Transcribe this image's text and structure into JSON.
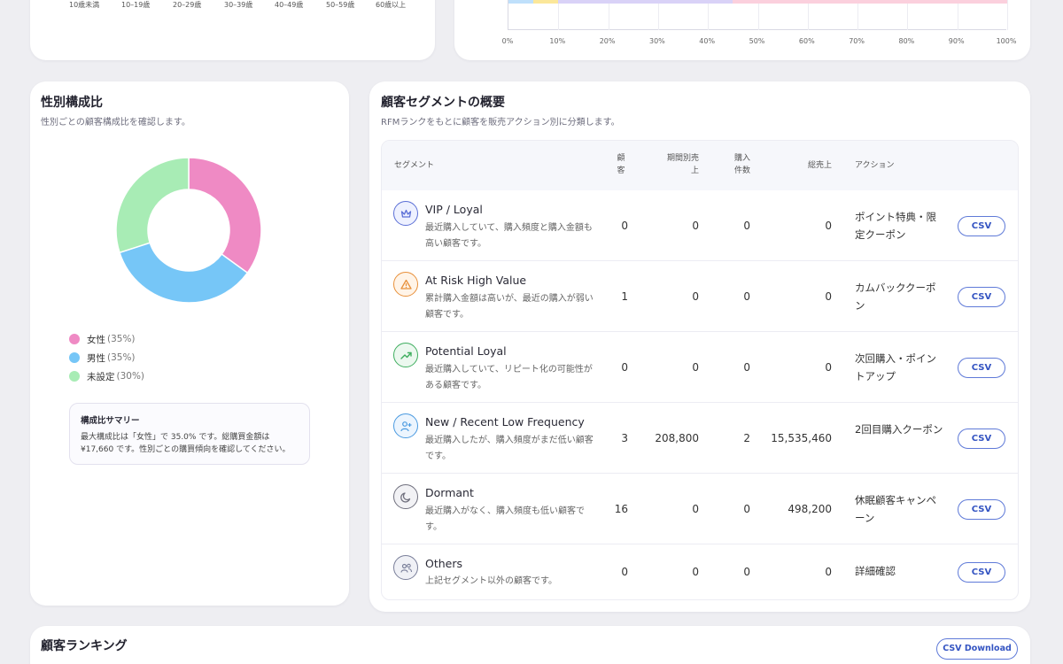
{
  "age_chart": {
    "tick_labels": [
      "10歳未満",
      "10–19歳",
      "20–29歳",
      "30–39歳",
      "40–49歳",
      "50–59歳",
      "60歳以上"
    ]
  },
  "stacked_bar": {
    "x_ticks": [
      "0%",
      "10%",
      "20%",
      "30%",
      "40%",
      "50%",
      "60%",
      "70%",
      "80%",
      "90%",
      "100%"
    ],
    "segment_colors": [
      "#bfe0fb",
      "#fbe79a",
      "#d9d2f7",
      "#fbd0dd"
    ],
    "segment_shares": [
      5,
      5,
      35,
      55
    ]
  },
  "gender": {
    "title": "性別構成比",
    "subtitle": "性別ごとの顧客構成比を確認します。",
    "legend": [
      {
        "label": "女性",
        "pct": "(35%)",
        "color": "#ef8ac4",
        "value": 35
      },
      {
        "label": "男性",
        "pct": "(35%)",
        "color": "#76c6f7",
        "value": 35
      },
      {
        "label": "未設定",
        "pct": "(30%)",
        "color": "#a8ecb5",
        "value": 30
      }
    ],
    "summary": {
      "title": "構成比サマリー",
      "text": "最大構成比は「女性」で 35.0% です。総購買金額は ¥17,660 です。性別ごとの購買傾向を確認してください。"
    }
  },
  "segments": {
    "title": "顧客セグメントの概要",
    "subtitle": "RFMランクをもとに顧客を販売アクション別に分類します。",
    "headers": {
      "segment": "セグメント",
      "customers": "顧\n客",
      "period_sales": "期間別売\n上",
      "purchase_count": "購入\n件数",
      "total_sales": "総売上",
      "action": "アクション"
    },
    "rows": [
      {
        "name": "VIP / Loyal",
        "desc": "最近購入していて、購入頻度と購入金額も高い顧客です。",
        "customers": "0",
        "period_sales": "0",
        "purchase_count": "0",
        "total_sales": "0",
        "action": "ポイント特典・限定クーポン",
        "csv": "CSV",
        "icon": "crown-icon",
        "icon_color": "#5b6fd6",
        "icon_bg": "#eef1ff"
      },
      {
        "name": "At Risk High Value",
        "desc": "累計購入金額は高いが、最近の購入が弱い顧客です。",
        "customers": "1",
        "period_sales": "0",
        "purchase_count": "0",
        "total_sales": "0",
        "action": "カムバッククーポン",
        "csv": "CSV",
        "icon": "warning-icon",
        "icon_color": "#e8903a",
        "icon_bg": "#fff4e8"
      },
      {
        "name": "Potential Loyal",
        "desc": "最近購入していて、リピート化の可能性がある顧客です。",
        "customers": "0",
        "period_sales": "0",
        "purchase_count": "0",
        "total_sales": "0",
        "action": "次回購入・ポイントアップ",
        "csv": "CSV",
        "icon": "trend-up-icon",
        "icon_color": "#3fae5f",
        "icon_bg": "#ecf8ef"
      },
      {
        "name": "New / Recent Low Frequency",
        "desc": "最近購入したが、購入頻度がまだ低い顧客です。",
        "customers": "3",
        "period_sales": "208,800",
        "purchase_count": "2",
        "total_sales": "15,535,460",
        "action": "2回目購入クーポン",
        "csv": "CSV",
        "icon": "user-plus-icon",
        "icon_color": "#4a9ae0",
        "icon_bg": "#ecf5fe"
      },
      {
        "name": "Dormant",
        "desc": "最近購入がなく、購入頻度も低い顧客です。",
        "customers": "16",
        "period_sales": "0",
        "purchase_count": "0",
        "total_sales": "498,200",
        "action": "休眠顧客キャンペーン",
        "csv": "CSV",
        "icon": "moon-icon",
        "icon_color": "#70707e",
        "icon_bg": "#f2f2f5"
      },
      {
        "name": "Others",
        "desc": "上記セグメント以外の顧客です。",
        "customers": "0",
        "period_sales": "0",
        "purchase_count": "0",
        "total_sales": "0",
        "action": "詳細確認",
        "csv": "CSV",
        "icon": "users-icon",
        "icon_color": "#7a7f9a",
        "icon_bg": "#f0f1f6"
      }
    ]
  },
  "ranking": {
    "title": "顧客ランキング",
    "csv_download": "CSV Download"
  }
}
